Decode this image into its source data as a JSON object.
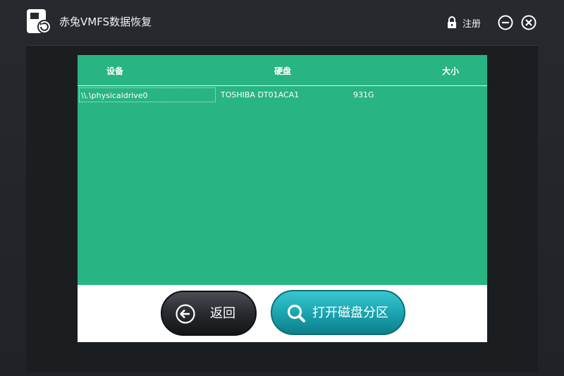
{
  "app": {
    "title": "赤兔VMFS数据恢复",
    "register_label": "注册"
  },
  "table": {
    "headers": {
      "device": "设备",
      "disk": "硬盘",
      "size": "大小"
    },
    "rows": [
      {
        "device": "\\\\.\\physicaldrive0",
        "disk": "TOSHIBA DT01ACA1",
        "size": "931G"
      }
    ]
  },
  "buttons": {
    "back_label": "返回",
    "open_label": "打开磁盘分区"
  },
  "colors": {
    "table_bg": "#28b483",
    "accent_teal": "#1ea9b4",
    "dark_button": "#2a2d31",
    "window_bg": "#202428"
  },
  "icons": {
    "logo": "disk-restore-icon",
    "register": "lock-icon",
    "minimize": "minimize-icon",
    "close": "close-icon",
    "back": "arrow-left-icon",
    "open": "search-icon"
  }
}
